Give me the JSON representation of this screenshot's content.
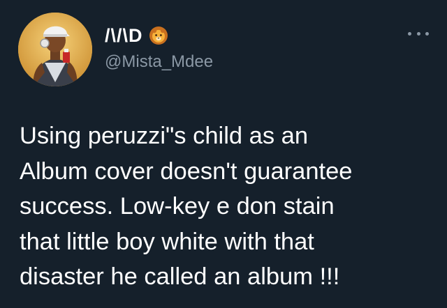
{
  "tweet": {
    "display_name": "/\\/\\D",
    "name_emoji": "lion-face-emoji",
    "handle": "@Mista_Mdee",
    "more_label": "···",
    "text": "Using peruzzi\"s child as an\nAlbum cover doesn't guarantee\nsuccess. Low-key e don stain\nthat little boy white with that\ndisaster he called an album !!!"
  },
  "colors": {
    "background": "#15202b",
    "text_primary": "#ffffff",
    "text_secondary": "#8b98a5"
  }
}
